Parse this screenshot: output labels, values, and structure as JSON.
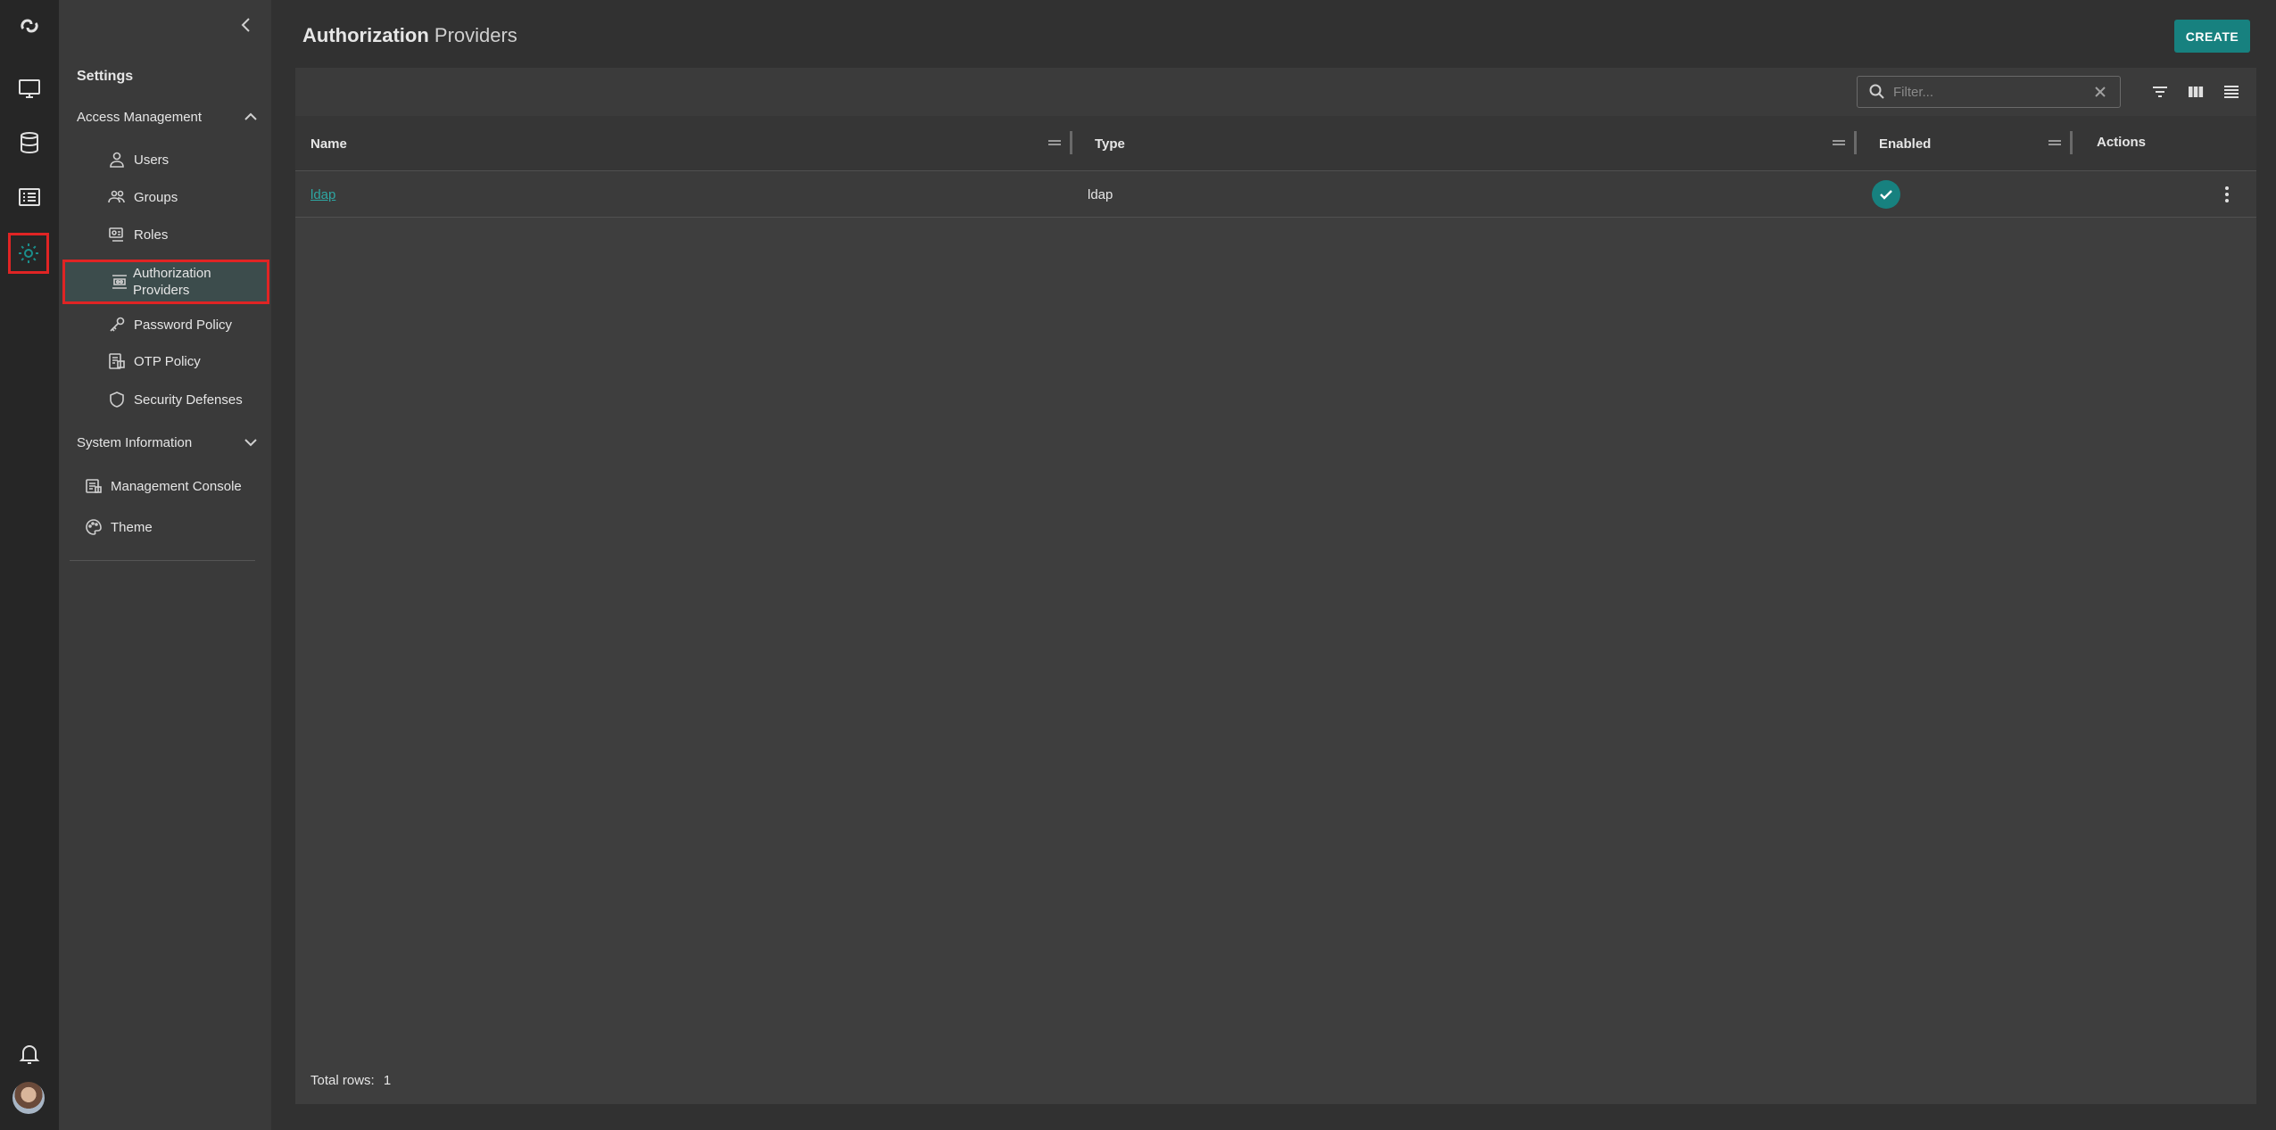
{
  "rail": {
    "items": [
      {
        "icon": "logo-icon"
      },
      {
        "icon": "monitor-icon"
      },
      {
        "icon": "database-icon"
      },
      {
        "icon": "list-icon"
      },
      {
        "icon": "gear-icon",
        "active": true
      }
    ],
    "bottom": [
      {
        "icon": "bell-icon"
      },
      {
        "icon": "avatar"
      }
    ]
  },
  "settings": {
    "title": "Settings",
    "access_management": {
      "label": "Access Management",
      "items": [
        {
          "label": "Users",
          "icon": "user-icon"
        },
        {
          "label": "Groups",
          "icon": "groups-icon"
        },
        {
          "label": "Roles",
          "icon": "roles-icon"
        },
        {
          "label": "Authorization Providers",
          "line1": "Authorization",
          "line2": "Providers",
          "icon": "authorization-providers-icon",
          "selected": true
        },
        {
          "label": "Password Policy",
          "icon": "key-icon"
        },
        {
          "label": "OTP Policy",
          "icon": "otp-icon"
        },
        {
          "label": "Security Defenses",
          "icon": "shield-icon"
        }
      ]
    },
    "system_information": {
      "label": "System Information",
      "items": [
        {
          "label": "Management Console",
          "icon": "console-icon"
        },
        {
          "label": "Theme",
          "icon": "palette-icon"
        }
      ]
    }
  },
  "header": {
    "title_bold": "Authorization",
    "title_light": "Providers",
    "create_label": "CREATE"
  },
  "toolbar": {
    "filter_placeholder": "Filter..."
  },
  "table": {
    "columns": [
      "Name",
      "Type",
      "Enabled",
      "Actions"
    ],
    "rows": [
      {
        "name": "ldap",
        "type": "ldap",
        "enabled": true
      }
    ]
  },
  "footer": {
    "total_rows_label": "Total rows:",
    "total_rows_value": "1"
  },
  "colors": {
    "accent": "#17817f",
    "link": "#2ea6a2",
    "highlight_border": "#e02424"
  }
}
